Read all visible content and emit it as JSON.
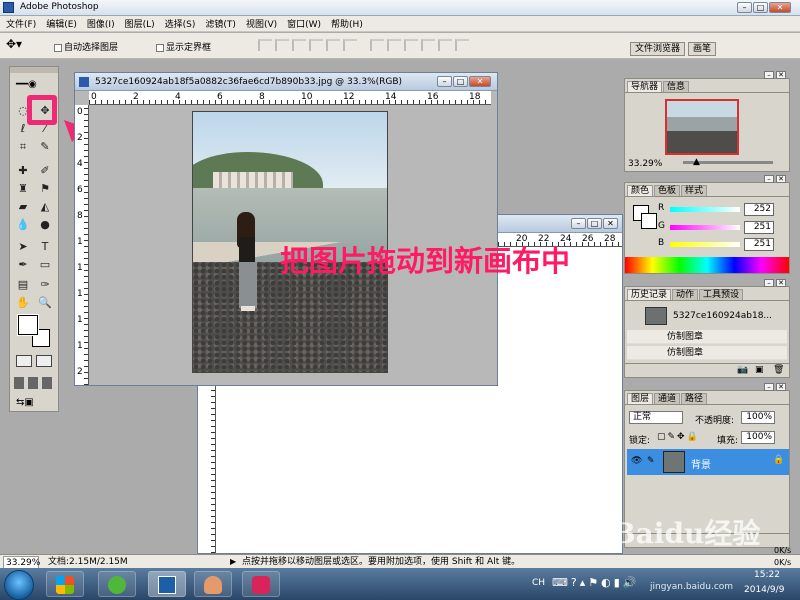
{
  "app": {
    "title": "Adobe Photoshop"
  },
  "menu": [
    "文件(F)",
    "编辑(E)",
    "图像(I)",
    "图层(L)",
    "选择(S)",
    "滤镜(T)",
    "视图(V)",
    "窗口(W)",
    "帮助(H)"
  ],
  "options_bar": {
    "auto_select_layer": "自动选择图层",
    "show_bounding_box": "显示定界框",
    "tab_file_browser": "文件浏览器",
    "tab_brushes": "画笔"
  },
  "document1": {
    "title": "5327ce160924ab18f5a0882c36fae6cd7b890b33.jpg @ 33.3%(RGB)",
    "ruler_labels": [
      "0",
      "2",
      "4",
      "6",
      "8",
      "10",
      "12",
      "14",
      "16",
      "18"
    ],
    "vruler_labels": [
      "0",
      "2",
      "4",
      "6",
      "8",
      "1",
      "1",
      "1",
      "1",
      "1",
      "2"
    ]
  },
  "document2": {
    "ruler_labels": [
      "20",
      "22",
      "24",
      "26",
      "28"
    ]
  },
  "annotation": {
    "text": "把图片拖动到新画布中"
  },
  "navigator": {
    "tabs": [
      "导航器",
      "信息"
    ],
    "zoom": "33.29%"
  },
  "color_panel": {
    "tabs": [
      "颜色",
      "色板",
      "样式"
    ],
    "channels": [
      {
        "label": "R",
        "value": "252"
      },
      {
        "label": "G",
        "value": "251"
      },
      {
        "label": "B",
        "value": "251"
      }
    ]
  },
  "history_panel": {
    "tabs": [
      "历史记录",
      "动作",
      "工具预设"
    ],
    "snapshot": "5327ce160924ab18...",
    "items": [
      "仿制图章",
      "仿制图章"
    ]
  },
  "layers_panel": {
    "tabs": [
      "图层",
      "通道",
      "路径"
    ],
    "blend_mode": "正常",
    "opacity_label": "不透明度:",
    "opacity": "100%",
    "lock_label": "锁定:",
    "fill_label": "填充:",
    "fill": "100%",
    "layer_name": "背景"
  },
  "status": {
    "zoom": "33.29%",
    "doc_size": "文档:2.15M/2.15M",
    "hint": "点按并拖移以移动图层或选区。要用附加选项，使用 Shift 和 Alt 键。"
  },
  "watermark": {
    "main": "Baidu经验",
    "sub": "jingyan.baidu.com"
  },
  "taskbar": {
    "ime": "CH",
    "time": "15:22",
    "date": "2014/9/9",
    "net1": "0K/s",
    "net2": "0K/s"
  }
}
